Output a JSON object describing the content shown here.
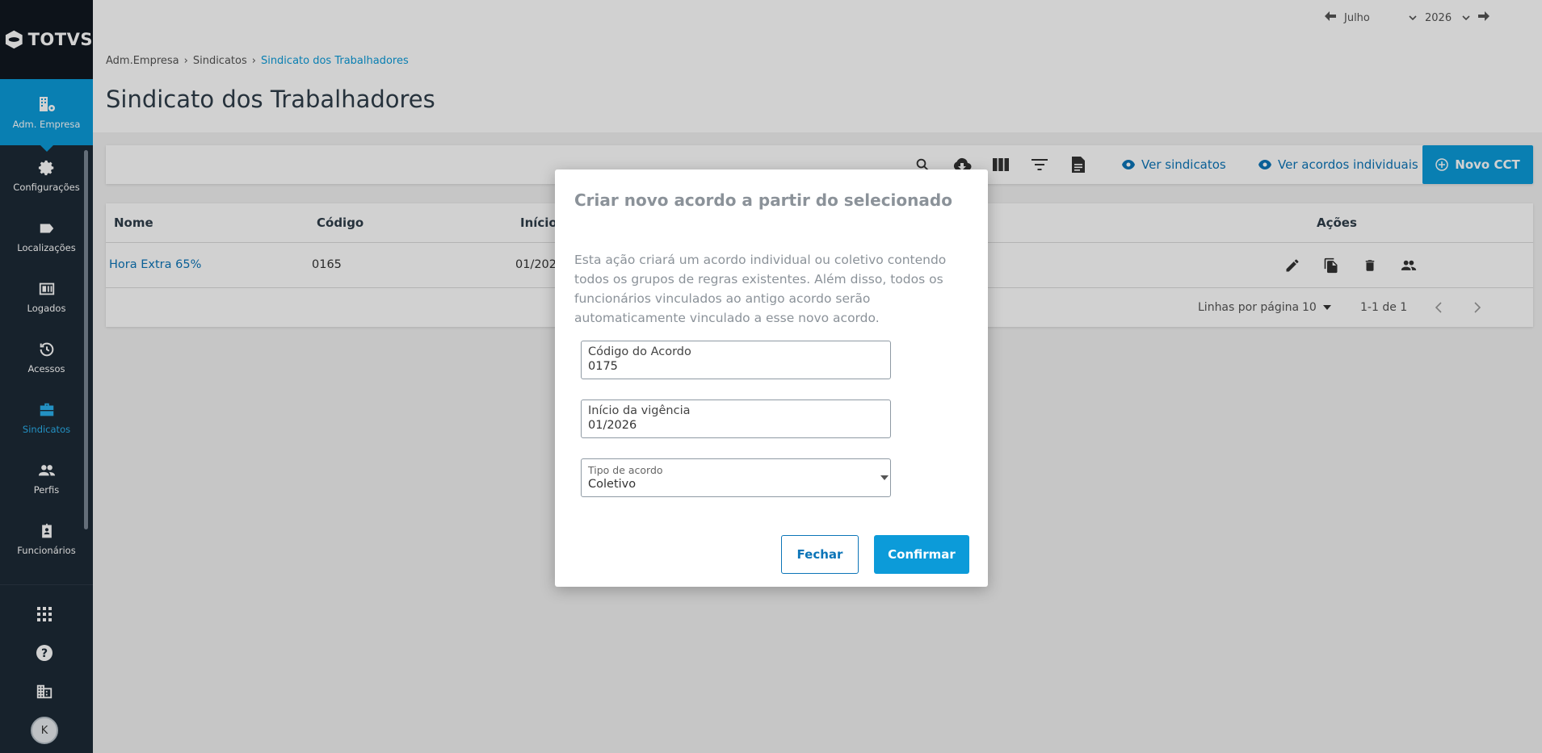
{
  "app": {
    "logo_text": "TOTVS"
  },
  "sidebar": {
    "items": [
      {
        "label": "Adm. Empresa",
        "icon": "building-gear-icon"
      },
      {
        "label": "Configurações",
        "icon": "gear-icon"
      },
      {
        "label": "Localizações",
        "icon": "tag-icon"
      },
      {
        "label": "Logados",
        "icon": "id-card-icon"
      },
      {
        "label": "Acessos",
        "icon": "history-icon"
      },
      {
        "label": "Sindicatos",
        "icon": "briefcase-icon"
      },
      {
        "label": "Perfis",
        "icon": "people-icon"
      },
      {
        "label": "Funcionários",
        "icon": "badge-icon"
      }
    ],
    "avatar_initial": "K"
  },
  "header": {
    "month": "Julho",
    "year": "2026",
    "breadcrumb": [
      "Adm.Empresa",
      "Sindicatos",
      "Sindicato dos Trabalhadores"
    ],
    "title": "Sindicato dos Trabalhadores"
  },
  "toolbar": {
    "ver_sindicatos": "Ver sindicatos",
    "ver_acordos": "Ver acordos individuais",
    "novo": "Novo CCT"
  },
  "table": {
    "columns": [
      "Nome",
      "Código",
      "Início",
      "Ações"
    ],
    "rows": [
      {
        "nome": "Hora Extra 65%",
        "codigo": "0165",
        "inicio": "01/2025"
      }
    ],
    "rows_per_page_label": "Linhas por página",
    "rows_per_page": "10",
    "range": "1-1 de 1"
  },
  "modal": {
    "title": "Criar novo acordo a partir do selecionado",
    "text": "Esta ação criará um acordo individual ou coletivo contendo todos os grupos de regras existentes. Além disso, todos os funcionários vinculados ao antigo acordo serão automaticamente vinculado a esse novo acordo.",
    "code_label": "Código do Acordo",
    "code_value": "0175",
    "start_label": "Início da vigência",
    "start_value": "01/2026",
    "type_label": "Tipo de acordo",
    "type_value": "Coletivo",
    "close": "Fechar",
    "confirm": "Confirmar"
  }
}
